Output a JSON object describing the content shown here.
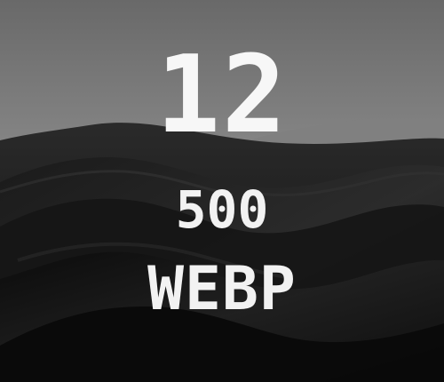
{
  "image": {
    "number": "12",
    "size": "500",
    "format": "WEBP"
  },
  "colors": {
    "sky_top": "#6f6f6f",
    "sky_bottom": "#a8a8a8",
    "mountain": "#7b7b7b",
    "dune_dark": "#111111",
    "dune_mid": "#202020",
    "text": "#f4f4f4"
  }
}
